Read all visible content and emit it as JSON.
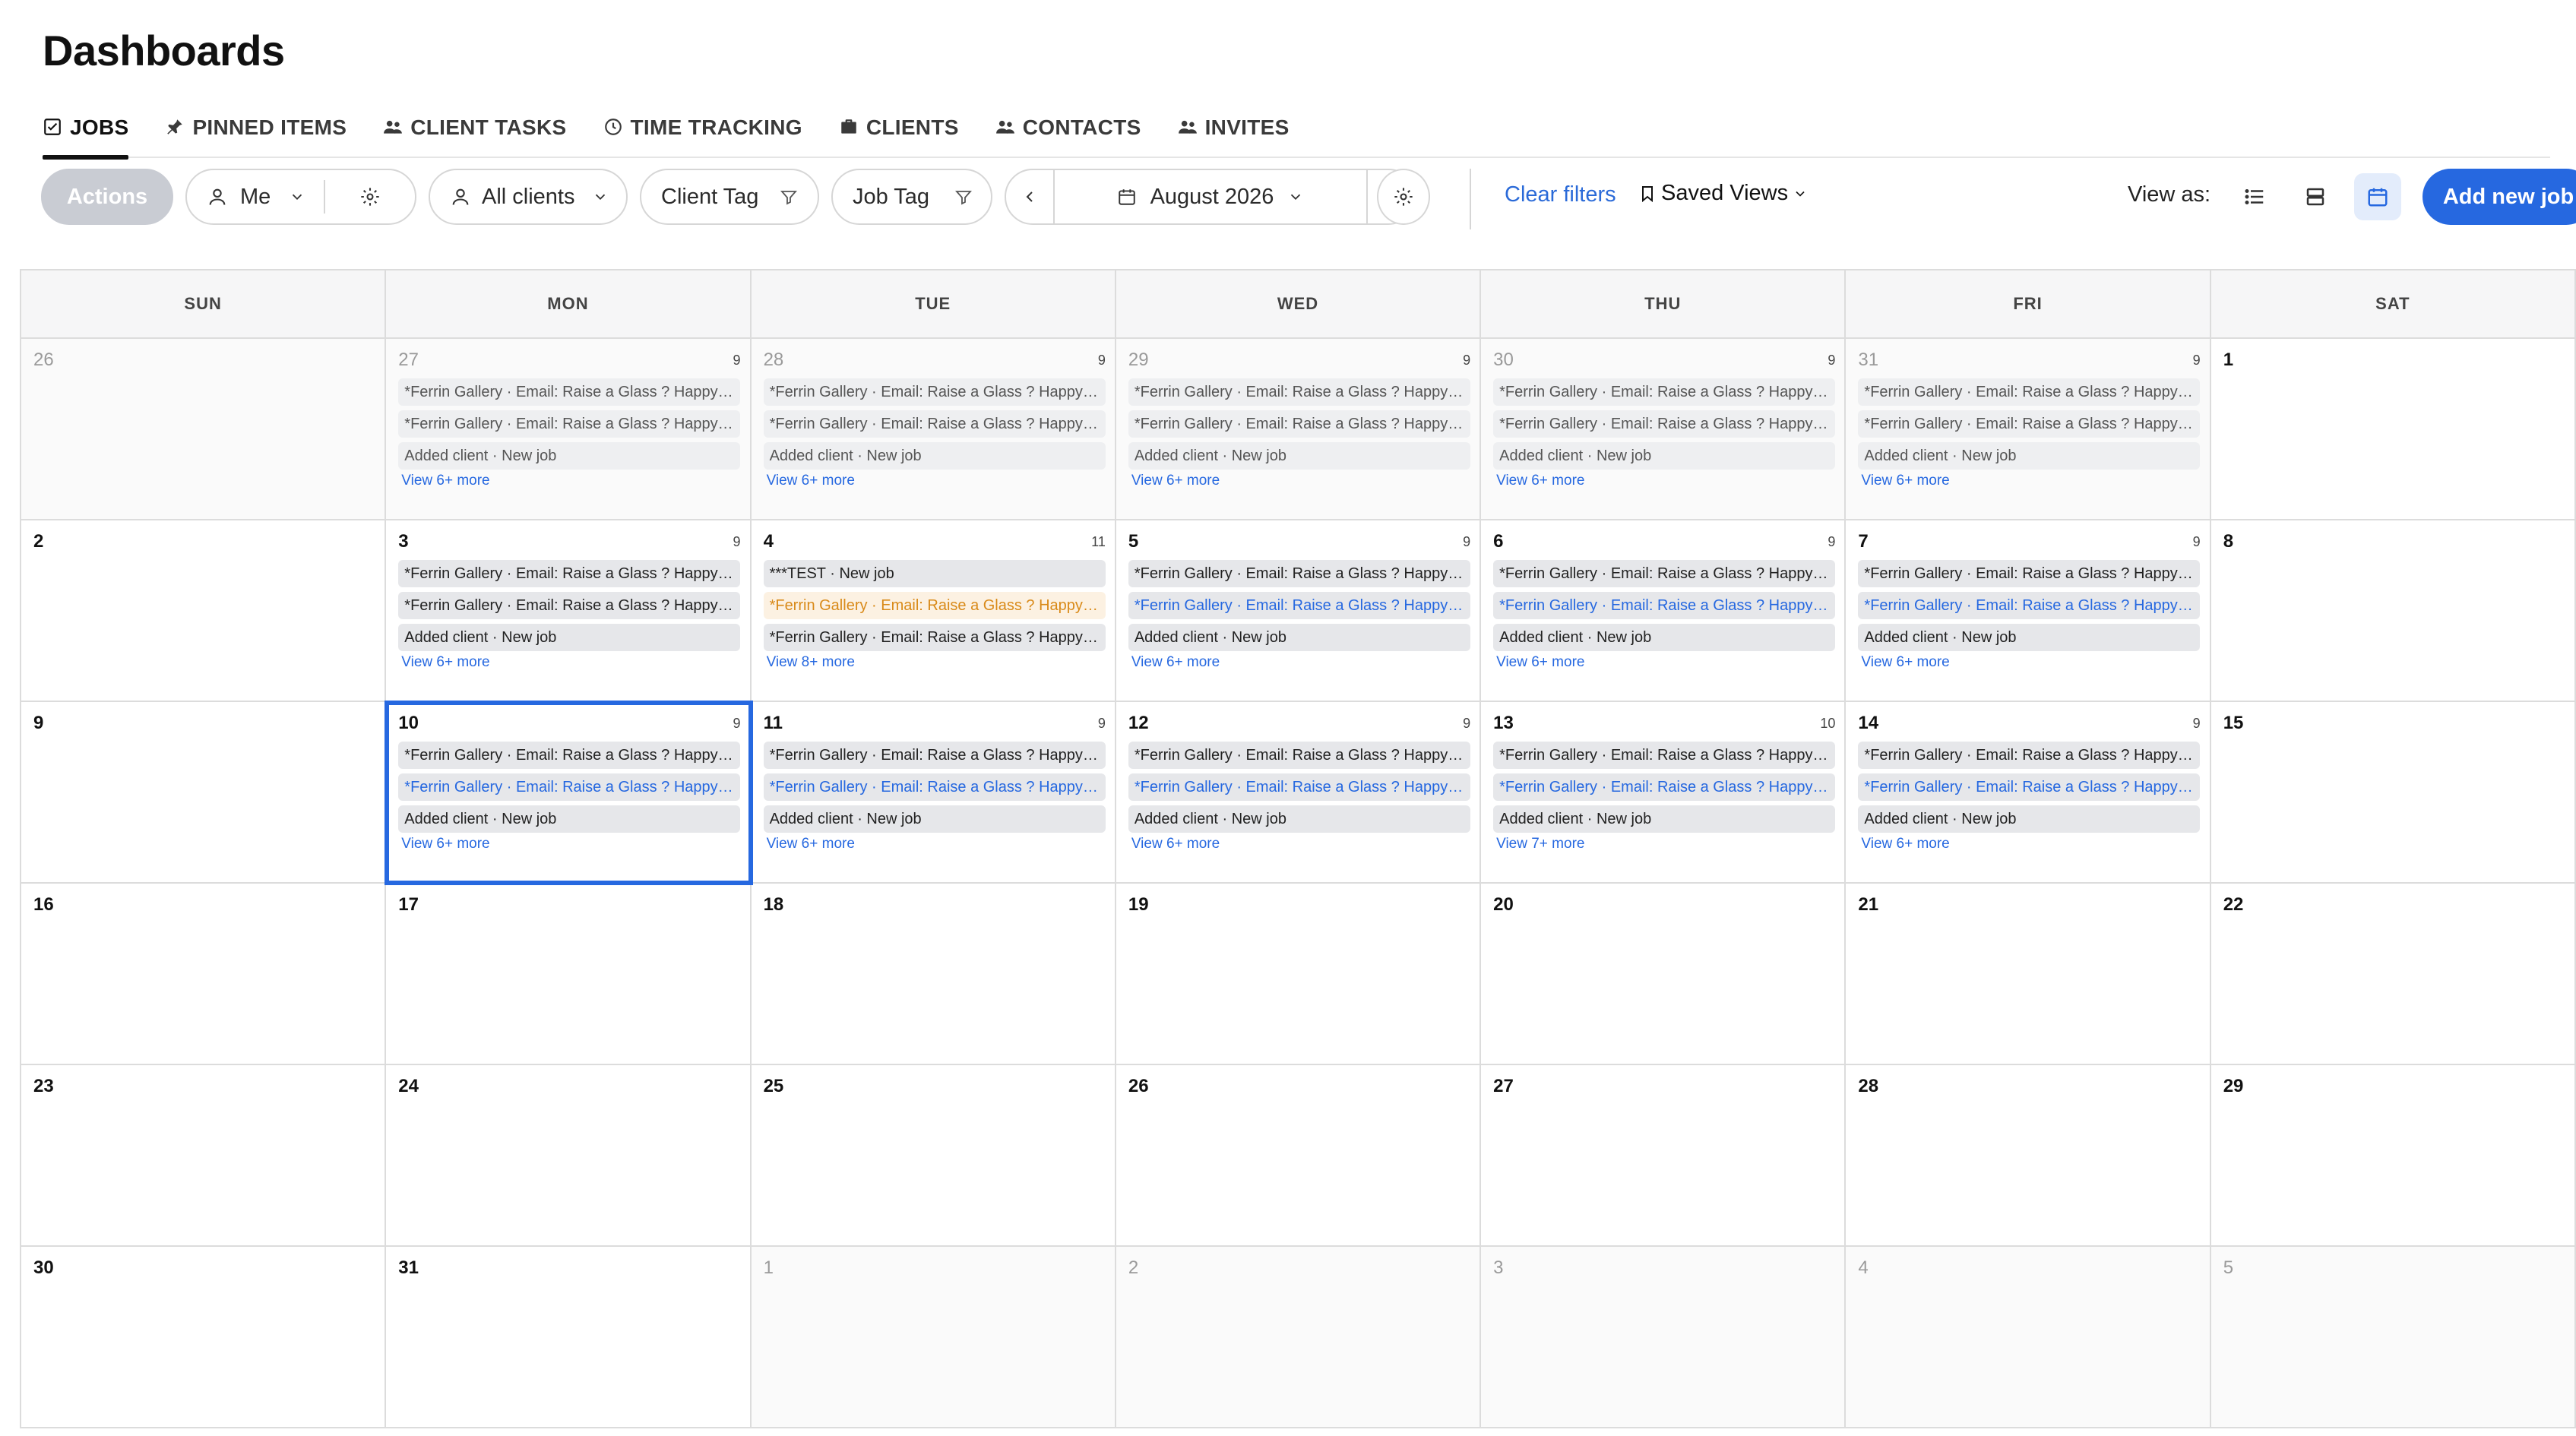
{
  "page_title": "Dashboards",
  "tabs": [
    {
      "label": "JOBS",
      "icon": "checkbox-icon",
      "active": true
    },
    {
      "label": "PINNED ITEMS",
      "icon": "pin-icon",
      "active": false
    },
    {
      "label": "CLIENT TASKS",
      "icon": "people-icon",
      "active": false
    },
    {
      "label": "TIME TRACKING",
      "icon": "clock-icon",
      "active": false
    },
    {
      "label": "CLIENTS",
      "icon": "briefcase-icon",
      "active": false
    },
    {
      "label": "CONTACTS",
      "icon": "people-icon",
      "active": false
    },
    {
      "label": "INVITES",
      "icon": "people-icon",
      "active": false
    }
  ],
  "toolbar": {
    "actions": "Actions",
    "me": "Me",
    "all_clients": "All clients",
    "client_tag": "Client Tag",
    "job_tag": "Job Tag",
    "month": "August 2026",
    "clear_filters": "Clear filters",
    "saved_views": "Saved Views",
    "view_as": "View as:",
    "add_new_job": "Add new job"
  },
  "calendar": {
    "weekdays": [
      "SUN",
      "MON",
      "TUE",
      "WED",
      "THU",
      "FRI",
      "SAT"
    ],
    "weeks": [
      [
        {
          "day": "26",
          "other": true
        },
        {
          "day": "27",
          "other": true,
          "count": "9",
          "events": [
            {
              "text": "*Ferrin Gallery · Email: Raise a Glass ? Happy Hour",
              "style": "light"
            },
            {
              "text": "*Ferrin Gallery · Email: Raise a Glass ? Happy Hour",
              "style": "light"
            },
            {
              "text": "Added client · New job",
              "style": "light"
            }
          ],
          "more": "View 6+ more"
        },
        {
          "day": "28",
          "other": true,
          "count": "9",
          "events": [
            {
              "text": "*Ferrin Gallery · Email: Raise a Glass ? Happy Hour",
              "style": "light"
            },
            {
              "text": "*Ferrin Gallery · Email: Raise a Glass ? Happy Hour",
              "style": "light"
            },
            {
              "text": "Added client · New job",
              "style": "light"
            }
          ],
          "more": "View 6+ more"
        },
        {
          "day": "29",
          "other": true,
          "count": "9",
          "events": [
            {
              "text": "*Ferrin Gallery · Email: Raise a Glass ? Happy Hour",
              "style": "light"
            },
            {
              "text": "*Ferrin Gallery · Email: Raise a Glass ? Happy Hour",
              "style": "light"
            },
            {
              "text": "Added client · New job",
              "style": "light"
            }
          ],
          "more": "View 6+ more"
        },
        {
          "day": "30",
          "other": true,
          "count": "9",
          "events": [
            {
              "text": "*Ferrin Gallery · Email: Raise a Glass ? Happy Hour",
              "style": "light"
            },
            {
              "text": "*Ferrin Gallery · Email: Raise a Glass ? Happy Hour",
              "style": "light"
            },
            {
              "text": "Added client · New job",
              "style": "light"
            }
          ],
          "more": "View 6+ more"
        },
        {
          "day": "31",
          "other": true,
          "count": "9",
          "events": [
            {
              "text": "*Ferrin Gallery · Email: Raise a Glass ? Happy Hour",
              "style": "light"
            },
            {
              "text": "*Ferrin Gallery · Email: Raise a Glass ? Happy Hour",
              "style": "light"
            },
            {
              "text": "Added client · New job",
              "style": "light"
            }
          ],
          "more": "View 6+ more"
        },
        {
          "day": "1"
        }
      ],
      [
        {
          "day": "2"
        },
        {
          "day": "3",
          "count": "9",
          "events": [
            {
              "text": "*Ferrin Gallery · Email: Raise a Glass ? Happy Hour",
              "style": "gray"
            },
            {
              "text": "*Ferrin Gallery · Email: Raise a Glass ? Happy Hour",
              "style": "gray"
            },
            {
              "text": "Added client · New job",
              "style": "gray"
            }
          ],
          "more": "View 6+ more"
        },
        {
          "day": "4",
          "count": "11",
          "events": [
            {
              "text": "***TEST · New job",
              "style": "gray"
            },
            {
              "text": "*Ferrin Gallery · Email: Raise a Glass ? Happy Hour",
              "style": "orange"
            },
            {
              "text": "*Ferrin Gallery · Email: Raise a Glass ? Happy Hour",
              "style": "gray"
            }
          ],
          "more": "View 8+ more"
        },
        {
          "day": "5",
          "count": "9",
          "events": [
            {
              "text": "*Ferrin Gallery · Email: Raise a Glass ? Happy Hour",
              "style": "gray"
            },
            {
              "text": "*Ferrin Gallery · Email: Raise a Glass ? Happy Hour",
              "style": "blue"
            },
            {
              "text": "Added client · New job",
              "style": "gray"
            }
          ],
          "more": "View 6+ more"
        },
        {
          "day": "6",
          "count": "9",
          "events": [
            {
              "text": "*Ferrin Gallery · Email: Raise a Glass ? Happy Hour",
              "style": "gray"
            },
            {
              "text": "*Ferrin Gallery · Email: Raise a Glass ? Happy Hour",
              "style": "blue"
            },
            {
              "text": "Added client · New job",
              "style": "gray"
            }
          ],
          "more": "View 6+ more"
        },
        {
          "day": "7",
          "count": "9",
          "events": [
            {
              "text": "*Ferrin Gallery · Email: Raise a Glass ? Happy Hour",
              "style": "gray"
            },
            {
              "text": "*Ferrin Gallery · Email: Raise a Glass ? Happy Hour",
              "style": "blue"
            },
            {
              "text": "Added client · New job",
              "style": "gray"
            }
          ],
          "more": "View 6+ more"
        },
        {
          "day": "8"
        }
      ],
      [
        {
          "day": "9"
        },
        {
          "day": "10",
          "count": "9",
          "selected": true,
          "events": [
            {
              "text": "*Ferrin Gallery · Email: Raise a Glass ? Happy Hour",
              "style": "gray"
            },
            {
              "text": "*Ferrin Gallery · Email: Raise a Glass ? Happy Hour",
              "style": "blue"
            },
            {
              "text": "Added client · New job",
              "style": "gray"
            }
          ],
          "more": "View 6+ more"
        },
        {
          "day": "11",
          "count": "9",
          "events": [
            {
              "text": "*Ferrin Gallery · Email: Raise a Glass ? Happy Hour",
              "style": "gray"
            },
            {
              "text": "*Ferrin Gallery · Email: Raise a Glass ? Happy Hour",
              "style": "blue"
            },
            {
              "text": "Added client · New job",
              "style": "gray"
            }
          ],
          "more": "View 6+ more"
        },
        {
          "day": "12",
          "count": "9",
          "events": [
            {
              "text": "*Ferrin Gallery · Email: Raise a Glass ? Happy Hour",
              "style": "gray"
            },
            {
              "text": "*Ferrin Gallery · Email: Raise a Glass ? Happy Hour",
              "style": "blue"
            },
            {
              "text": "Added client · New job",
              "style": "gray"
            }
          ],
          "more": "View 6+ more"
        },
        {
          "day": "13",
          "count": "10",
          "events": [
            {
              "text": "*Ferrin Gallery · Email: Raise a Glass ? Happy Hour",
              "style": "gray"
            },
            {
              "text": "*Ferrin Gallery · Email: Raise a Glass ? Happy Hour",
              "style": "blue"
            },
            {
              "text": "Added client · New job",
              "style": "gray"
            }
          ],
          "more": "View 7+ more"
        },
        {
          "day": "14",
          "count": "9",
          "events": [
            {
              "text": "*Ferrin Gallery · Email: Raise a Glass ? Happy Hour",
              "style": "gray"
            },
            {
              "text": "*Ferrin Gallery · Email: Raise a Glass ? Happy Hour",
              "style": "blue"
            },
            {
              "text": "Added client · New job",
              "style": "gray"
            }
          ],
          "more": "View 6+ more"
        },
        {
          "day": "15"
        }
      ],
      [
        {
          "day": "16"
        },
        {
          "day": "17"
        },
        {
          "day": "18"
        },
        {
          "day": "19"
        },
        {
          "day": "20"
        },
        {
          "day": "21"
        },
        {
          "day": "22"
        }
      ],
      [
        {
          "day": "23"
        },
        {
          "day": "24"
        },
        {
          "day": "25"
        },
        {
          "day": "26"
        },
        {
          "day": "27"
        },
        {
          "day": "28"
        },
        {
          "day": "29"
        }
      ],
      [
        {
          "day": "30"
        },
        {
          "day": "31"
        },
        {
          "day": "1",
          "other": true
        },
        {
          "day": "2",
          "other": true
        },
        {
          "day": "3",
          "other": true
        },
        {
          "day": "4",
          "other": true
        },
        {
          "day": "5",
          "other": true
        }
      ]
    ]
  }
}
